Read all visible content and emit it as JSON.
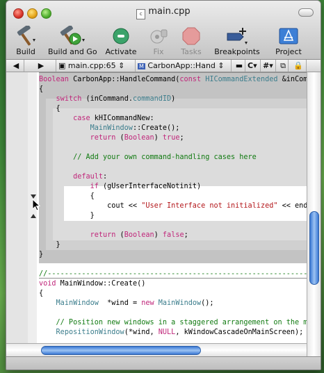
{
  "window": {
    "title": "main.cpp"
  },
  "toolbar": [
    {
      "name": "build-button",
      "icon": "hammer-icon",
      "label": "Build",
      "disabled": false
    },
    {
      "name": "build-and-go-button",
      "icon": "hammer-go-icon",
      "label": "Build and Go",
      "disabled": false
    },
    {
      "name": "activate-button",
      "icon": "activate-icon",
      "label": "Activate",
      "disabled": false
    },
    {
      "name": "fix-button",
      "icon": "fix-icon",
      "label": "Fix",
      "disabled": true
    },
    {
      "name": "tasks-button",
      "icon": "stop-icon",
      "label": "Tasks",
      "disabled": true
    },
    {
      "name": "breakpoints-button",
      "icon": "breakpoint-icon",
      "label": "Breakpoints",
      "disabled": false
    },
    {
      "name": "project-button",
      "icon": "project-icon",
      "label": "Project",
      "disabled": false
    }
  ],
  "navbar": {
    "file_popup": "main.cpp:65",
    "function_popup": "CarbonApp::Hand",
    "class_popup": "C",
    "include_popup": "#"
  },
  "code_lines": [
    {
      "text": "Boolean CarbonApp::HandleCommand(const HICommandExtended &inComm"
    },
    {
      "text": "{"
    },
    {
      "text": "    switch (inCommand.commandID)"
    },
    {
      "text": "    {"
    },
    {
      "text": "        case kHICommandNew:"
    },
    {
      "text": "            MainWindow::Create();"
    },
    {
      "text": "            return (Boolean) true;"
    },
    {
      "text": ""
    },
    {
      "text": "        // Add your own command-handling cases here"
    },
    {
      "text": ""
    },
    {
      "text": "        default:"
    },
    {
      "text": "            if (gUserInterfaceNotinit)"
    },
    {
      "text": "            {"
    },
    {
      "text": "                cout << \"User Interface not initialized\" << end"
    },
    {
      "text": "            }"
    },
    {
      "text": ""
    },
    {
      "text": "            return (Boolean) false;"
    },
    {
      "text": "    }"
    },
    {
      "text": "}"
    },
    {
      "text": ""
    },
    {
      "text": "//-------------------------------------------------------------------"
    },
    {
      "text": "void MainWindow::Create()"
    },
    {
      "text": "{"
    },
    {
      "text": "    MainWindow  *wind = new MainWindow();"
    },
    {
      "text": ""
    },
    {
      "text": "    // Position new windows in a staggered arrangement on the ma"
    },
    {
      "text": "    RepositionWindow(*wind, NULL, kWindowCascadeOnMainScreen);"
    }
  ],
  "colors": {
    "keyword": "#c0267a",
    "type": "#3b7d8c",
    "comment": "#117a11",
    "string": "#b3161a",
    "accent": "#3a78d4"
  }
}
